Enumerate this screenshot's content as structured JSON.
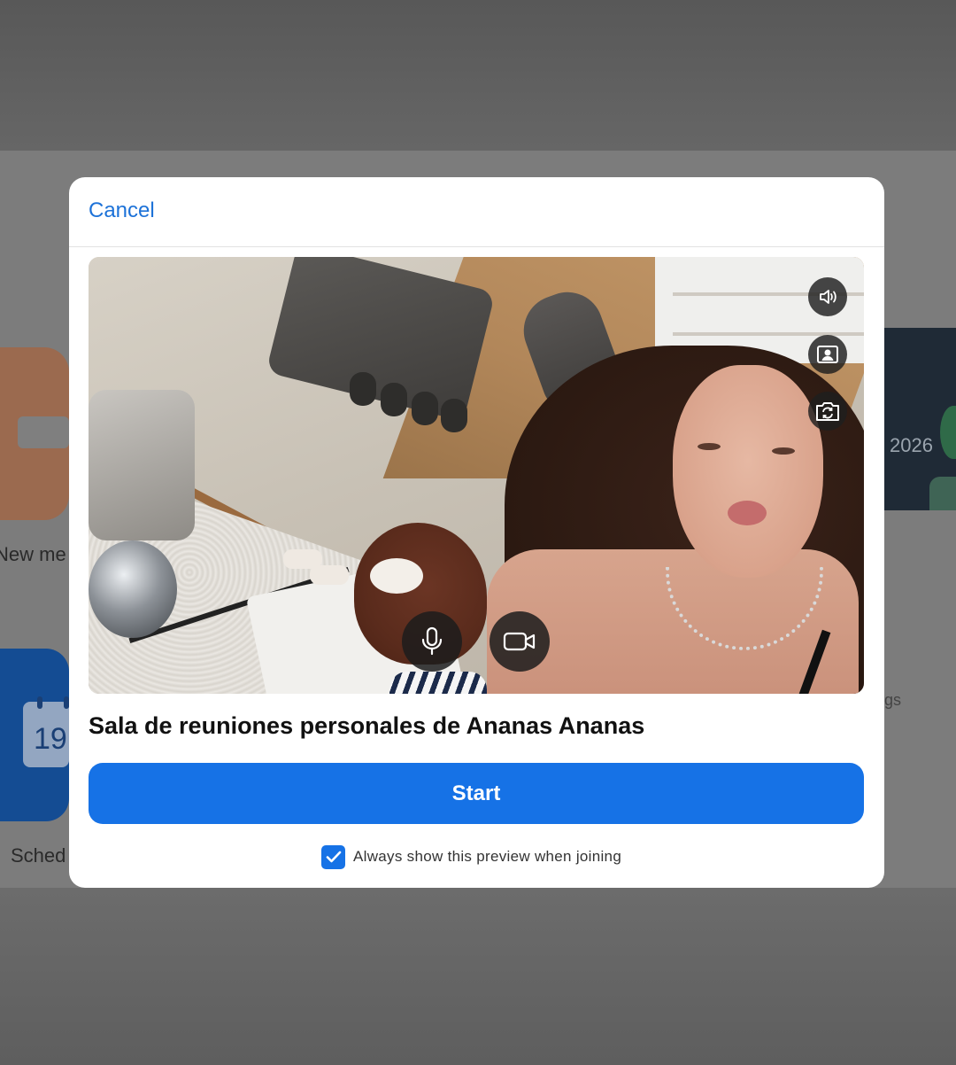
{
  "background": {
    "new_meeting_label": "New me",
    "schedule_label": "Sched",
    "calendar_day": "19",
    "year_label": "2026",
    "settings_label_fragment": "gs"
  },
  "modal": {
    "cancel_label": "Cancel",
    "room_title": "Sala de reuniones personales de Ananas Ananas",
    "start_label": "Start",
    "always_show_preview": {
      "label": "Always show this preview when joining",
      "checked": true
    }
  },
  "preview_controls": {
    "speaker_icon": "speaker-icon",
    "virtual_background_icon": "person-frame-icon",
    "switch_camera_icon": "camera-switch-icon",
    "microphone_icon": "microphone-icon",
    "video_icon": "video-camera-icon"
  },
  "colors": {
    "accent": "#1672e6",
    "link": "#1d72d8"
  }
}
